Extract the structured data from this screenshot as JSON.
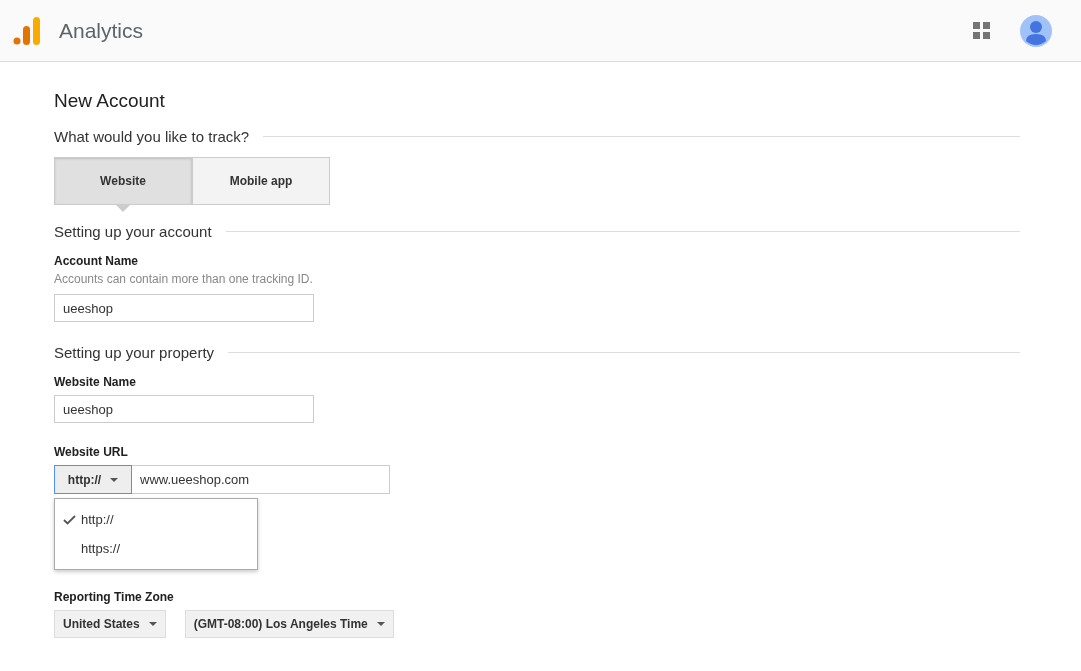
{
  "header": {
    "title": "Analytics"
  },
  "page_title": "New Account",
  "track_section": {
    "heading": "What would you like to track?",
    "options": [
      {
        "label": "Website",
        "selected": true
      },
      {
        "label": "Mobile app",
        "selected": false
      }
    ]
  },
  "account_section": {
    "heading": "Setting up your account",
    "label": "Account Name",
    "hint": "Accounts can contain more than one tracking ID.",
    "value": "ueeshop"
  },
  "property_section": {
    "heading": "Setting up your property",
    "website_name": {
      "label": "Website Name",
      "value": "ueeshop"
    },
    "website_url": {
      "label": "Website URL",
      "protocol": "http://",
      "value": "www.ueeshop.com",
      "menu": [
        {
          "label": "http://",
          "selected": true
        },
        {
          "label": "https://",
          "selected": false
        }
      ]
    },
    "time_zone": {
      "label": "Reporting Time Zone",
      "country": "United States",
      "zone": "(GMT-08:00) Los Angeles Time"
    }
  }
}
